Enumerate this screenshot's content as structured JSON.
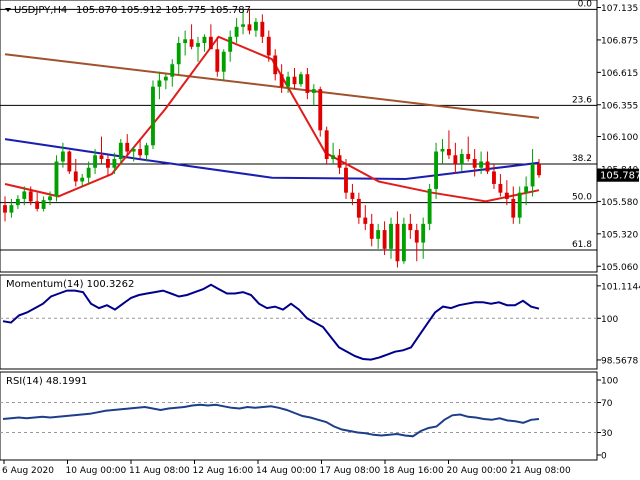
{
  "header": {
    "symbol_tf": "USDJPY,H4",
    "ohlc": "105.870 105.912 105.775 105.787",
    "current_price": "105.787"
  },
  "colors": {
    "bull": "#00A000",
    "bear": "#E00000",
    "ma_red": "#E21B1B",
    "ma_blue": "#1B1FB0",
    "ma_brown": "#A0522D",
    "momentum": "#00008B",
    "rsi": "#1E3E8C",
    "price_tag_bg": "#000000"
  },
  "chart_data": [
    {
      "type": "candlestick",
      "name": "USDJPY,H4",
      "ylim": [
        105.03,
        107.155
      ],
      "price_ticks": [
        "107.135",
        "106.875",
        "106.615",
        "106.355",
        "106.100",
        "105.840",
        "105.580",
        "105.320",
        "105.060"
      ],
      "fibonacci": [
        {
          "label": "0.0",
          "price": 107.12
        },
        {
          "label": "23.6",
          "price": 106.35
        },
        {
          "label": "38.2",
          "price": 105.88
        },
        {
          "label": "50.0",
          "price": 105.57
        },
        {
          "label": "61.8",
          "price": 105.19
        }
      ],
      "candles": [
        [
          105.55,
          105.62,
          105.42,
          105.49
        ],
        [
          105.49,
          105.6,
          105.45,
          105.55
        ],
        [
          105.55,
          105.63,
          105.52,
          105.6
        ],
        [
          105.6,
          105.7,
          105.55,
          105.66
        ],
        [
          105.66,
          105.7,
          105.55,
          105.58
        ],
        [
          105.58,
          105.65,
          105.5,
          105.52
        ],
        [
          105.52,
          105.62,
          105.5,
          105.59
        ],
        [
          105.59,
          105.66,
          105.55,
          105.62
        ],
        [
          105.62,
          105.95,
          105.58,
          105.9
        ],
        [
          105.9,
          106.05,
          105.85,
          105.98
        ],
        [
          105.98,
          105.99,
          105.8,
          105.82
        ],
        [
          105.82,
          105.92,
          105.7,
          105.74
        ],
        [
          105.74,
          105.8,
          105.7,
          105.77
        ],
        [
          105.77,
          105.9,
          105.72,
          105.85
        ],
        [
          105.85,
          106.0,
          105.8,
          105.95
        ],
        [
          105.95,
          106.1,
          105.88,
          105.92
        ],
        [
          105.92,
          105.95,
          105.78,
          105.85
        ],
        [
          105.85,
          105.97,
          105.8,
          105.92
        ],
        [
          105.92,
          106.08,
          105.88,
          106.05
        ],
        [
          106.05,
          106.12,
          105.95,
          105.98
        ],
        [
          105.98,
          106.02,
          105.9,
          106.0
        ],
        [
          106.0,
          106.08,
          105.92,
          105.95
        ],
        [
          105.95,
          106.05,
          105.9,
          106.03
        ],
        [
          106.03,
          106.55,
          106.0,
          106.5
        ],
        [
          106.5,
          106.62,
          106.4,
          106.55
        ],
        [
          106.55,
          106.6,
          106.48,
          106.58
        ],
        [
          106.58,
          106.72,
          106.5,
          106.68
        ],
        [
          106.68,
          106.9,
          106.6,
          106.85
        ],
        [
          106.85,
          106.95,
          106.75,
          106.88
        ],
        [
          106.88,
          107.0,
          106.8,
          106.82
        ],
        [
          106.82,
          106.9,
          106.7,
          106.85
        ],
        [
          106.85,
          106.92,
          106.78,
          106.9
        ],
        [
          106.9,
          107.0,
          106.85,
          106.8
        ],
        [
          106.8,
          106.9,
          106.58,
          106.62
        ],
        [
          106.62,
          106.8,
          106.55,
          106.78
        ],
        [
          106.78,
          106.95,
          106.7,
          106.9
        ],
        [
          106.9,
          107.05,
          106.85,
          106.98
        ],
        [
          106.98,
          107.12,
          106.92,
          107.0
        ],
        [
          107.0,
          107.12,
          106.92,
          106.95
        ],
        [
          106.95,
          107.05,
          106.9,
          107.02
        ],
        [
          107.02,
          107.08,
          106.85,
          106.9
        ],
        [
          106.9,
          106.95,
          106.7,
          106.75
        ],
        [
          106.75,
          106.8,
          106.55,
          106.6
        ],
        [
          106.6,
          106.68,
          106.45,
          106.5
        ],
        [
          106.5,
          106.62,
          106.45,
          106.58
        ],
        [
          106.58,
          106.65,
          106.48,
          106.52
        ],
        [
          106.52,
          106.62,
          106.5,
          106.6
        ],
        [
          106.6,
          106.65,
          106.4,
          106.45
        ],
        [
          106.45,
          106.52,
          106.35,
          106.48
        ],
        [
          106.48,
          106.5,
          106.1,
          106.15
        ],
        [
          106.15,
          106.18,
          105.88,
          105.92
        ],
        [
          105.92,
          106.05,
          105.88,
          105.95
        ],
        [
          105.95,
          106.0,
          105.8,
          105.85
        ],
        [
          105.85,
          105.92,
          105.6,
          105.65
        ],
        [
          105.65,
          105.72,
          105.55,
          105.6
        ],
        [
          105.6,
          105.65,
          105.4,
          105.45
        ],
        [
          105.45,
          105.55,
          105.35,
          105.4
        ],
        [
          105.4,
          105.48,
          105.22,
          105.28
        ],
        [
          105.28,
          105.4,
          105.2,
          105.35
        ],
        [
          105.35,
          105.42,
          105.15,
          105.2
        ],
        [
          105.2,
          105.45,
          105.12,
          105.4
        ],
        [
          105.4,
          105.5,
          105.05,
          105.1
        ],
        [
          105.1,
          105.45,
          105.08,
          105.4
        ],
        [
          105.4,
          105.48,
          105.28,
          105.35
        ],
        [
          105.35,
          105.4,
          105.1,
          105.25
        ],
        [
          105.25,
          105.45,
          105.12,
          105.4
        ],
        [
          105.4,
          105.72,
          105.35,
          105.68
        ],
        [
          105.68,
          106.05,
          105.6,
          105.98
        ],
        [
          105.98,
          106.08,
          105.88,
          106.0
        ],
        [
          106.0,
          106.15,
          105.92,
          105.95
        ],
        [
          105.95,
          106.05,
          105.8,
          105.88
        ],
        [
          105.88,
          106.0,
          105.82,
          105.96
        ],
        [
          105.96,
          106.1,
          105.9,
          105.92
        ],
        [
          105.92,
          106.0,
          105.78,
          105.85
        ],
        [
          105.85,
          105.98,
          105.8,
          105.9
        ],
        [
          105.9,
          105.98,
          105.8,
          105.82
        ],
        [
          105.82,
          105.88,
          105.68,
          105.72
        ],
        [
          105.72,
          105.8,
          105.62,
          105.65
        ],
        [
          105.65,
          105.75,
          105.55,
          105.6
        ],
        [
          105.6,
          105.7,
          105.4,
          105.45
        ],
        [
          105.45,
          105.7,
          105.4,
          105.65
        ],
        [
          105.65,
          105.78,
          105.55,
          105.7
        ],
        [
          105.7,
          106.0,
          105.62,
          105.88
        ],
        [
          105.88,
          105.92,
          105.77,
          105.79
        ]
      ],
      "moving_averages": [
        {
          "color_key": "ma_brown",
          "values": [
            106.76,
            106.25
          ]
        },
        {
          "color_key": "ma_blue",
          "values": [
            106.08,
            105.92,
            105.77,
            105.76,
            105.89
          ]
        },
        {
          "color_key": "ma_red",
          "values": [
            105.72,
            105.62,
            105.8,
            106.32,
            106.9,
            106.72,
            105.97,
            105.74,
            105.65,
            105.58,
            105.67
          ]
        }
      ]
    },
    {
      "type": "line",
      "name": "Momentum(14)",
      "title": "Momentum(14) 100.3262",
      "ylim": [
        98.36,
        101.35
      ],
      "ticks": [
        "101.1144",
        "100",
        "98.5678"
      ],
      "reference_lines": [
        100.0
      ],
      "values": [
        99.9,
        99.85,
        100.1,
        100.2,
        100.35,
        100.5,
        100.75,
        100.85,
        100.95,
        100.95,
        100.9,
        100.5,
        100.35,
        100.45,
        100.3,
        100.5,
        100.7,
        100.8,
        100.85,
        100.9,
        100.95,
        100.85,
        100.75,
        100.8,
        100.9,
        101.0,
        101.15,
        101.0,
        100.85,
        100.85,
        100.9,
        100.8,
        100.5,
        100.35,
        100.4,
        100.3,
        100.5,
        100.3,
        100.0,
        99.85,
        99.7,
        99.35,
        99.0,
        98.85,
        98.7,
        98.6,
        98.58,
        98.65,
        98.75,
        98.85,
        98.9,
        99.0,
        99.4,
        99.8,
        100.2,
        100.4,
        100.35,
        100.45,
        100.5,
        100.55,
        100.55,
        100.5,
        100.55,
        100.45,
        100.45,
        100.6,
        100.4,
        100.33
      ]
    },
    {
      "type": "line",
      "name": "RSI(14)",
      "title": "RSI(14) 48.1991",
      "ylim": [
        0,
        100
      ],
      "ticks": [
        "100",
        "70",
        "30",
        "0"
      ],
      "reference_lines": [
        70,
        30
      ],
      "values": [
        48,
        49,
        50,
        49,
        50,
        51,
        50,
        51,
        52,
        53,
        54,
        55,
        57,
        59,
        60,
        61,
        62,
        63,
        64,
        62,
        60,
        62,
        63,
        64,
        66,
        67,
        66,
        67,
        65,
        63,
        62,
        64,
        63,
        64,
        65,
        63,
        60,
        56,
        52,
        50,
        47,
        44,
        38,
        34,
        32,
        30,
        29,
        27,
        26,
        27,
        28,
        26,
        25,
        32,
        36,
        38,
        47,
        53,
        54,
        51,
        50,
        48,
        47,
        49,
        46,
        45,
        43,
        47,
        48
      ]
    },
    {
      "type": "axis",
      "x_ticks": [
        "6 Aug 2020",
        "10 Aug 00:00",
        "11 Aug 08:00",
        "12 Aug 16:00",
        "14 Aug 00:00",
        "17 Aug 08:00",
        "18 Aug 16:00",
        "20 Aug 00:00",
        "21 Aug 08:00"
      ]
    }
  ]
}
